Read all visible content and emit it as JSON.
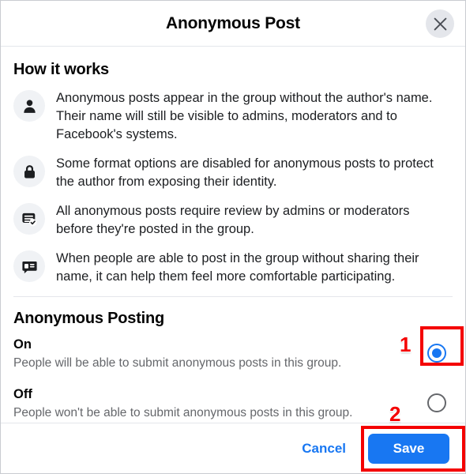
{
  "dialog": {
    "title": "Anonymous Post",
    "close_icon": "close-icon"
  },
  "how_it_works": {
    "heading": "How it works",
    "items": [
      {
        "icon": "person-icon",
        "text": "Anonymous posts appear in the group without the author's name. Their name will still be visible to admins, moderators and to Facebook's systems."
      },
      {
        "icon": "lock-icon",
        "text": "Some format options are disabled for anonymous posts to protect the author from exposing their identity."
      },
      {
        "icon": "post-review-icon",
        "text": "All anonymous posts require review by admins or moderators before they're posted in the group."
      },
      {
        "icon": "comment-icon",
        "text": "When people are able to post in the group without sharing their name, it can help them feel more comfortable participating."
      }
    ]
  },
  "anonymous_posting": {
    "heading": "Anonymous Posting",
    "options": [
      {
        "name": "On",
        "description": "People will be able to submit anonymous posts in this group.",
        "selected": true
      },
      {
        "name": "Off",
        "description": "People won't be able to submit anonymous posts in this group.",
        "selected": false
      }
    ]
  },
  "footer": {
    "cancel_label": "Cancel",
    "save_label": "Save"
  },
  "annotations": {
    "step_1": "1",
    "step_2": "2",
    "color": "#f40000"
  },
  "colors": {
    "accent": "#1877f2",
    "text_primary": "#050505",
    "text_secondary": "#65676b",
    "icon_bg": "#f0f2f5",
    "divider": "#e4e6eb"
  }
}
